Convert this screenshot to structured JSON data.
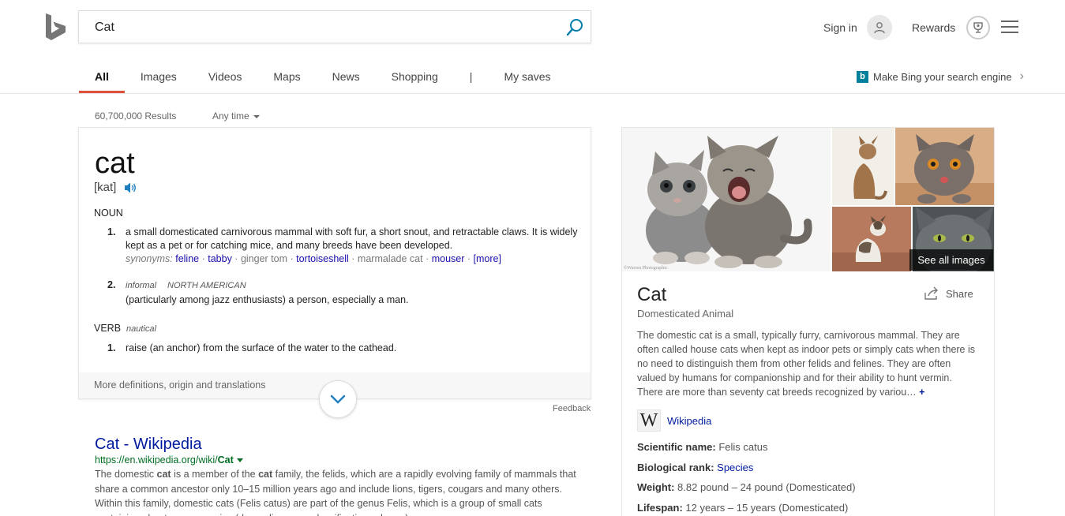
{
  "search": {
    "query": "Cat"
  },
  "header": {
    "signin_label": "Sign in",
    "rewards_label": "Rewards",
    "make_bing_label": "Make Bing your search engine"
  },
  "tabs": [
    {
      "label": "All",
      "active": true
    },
    {
      "label": "Images"
    },
    {
      "label": "Videos"
    },
    {
      "label": "Maps"
    },
    {
      "label": "News"
    },
    {
      "label": "Shopping"
    },
    {
      "label": "|"
    },
    {
      "label": "My saves"
    }
  ],
  "meta": {
    "result_count": "60,700,000 Results",
    "time_filter": "Any time"
  },
  "dictionary": {
    "word": "cat",
    "pronunciation": "[kat]",
    "noun_label": "NOUN",
    "noun_defs": [
      {
        "num": "1.",
        "text": "a small domesticated carnivorous mammal with soft fur, a short snout, and retractable claws. It is widely kept as a pet or for catching mice, and many breeds have been developed."
      },
      {
        "num": "2.",
        "labels": "informal",
        "region": "NORTH AMERICAN",
        "text": "(particularly among jazz enthusiasts) a person, especially a man."
      }
    ],
    "synonyms_label": "synonyms:",
    "synonyms": [
      {
        "text": "feline",
        "link": true
      },
      {
        "text": "tabby",
        "link": true
      },
      {
        "text": "ginger tom",
        "link": false
      },
      {
        "text": "tortoiseshell",
        "link": true
      },
      {
        "text": "marmalade cat",
        "link": false
      },
      {
        "text": "mouser",
        "link": true
      }
    ],
    "more_label": "[more]",
    "verb_label": "VERB",
    "verb_tag": "nautical",
    "verb_defs": [
      {
        "num": "1.",
        "text": "raise (an anchor) from the surface of the water to the cathead."
      }
    ],
    "more_definitions": "More definitions, origin and translations",
    "feedback": "Feedback"
  },
  "wiki_result": {
    "title": "Cat - Wikipedia",
    "url_prefix": "https://en.wikipedia.org/wiki/",
    "url_bold": "Cat",
    "snippet_parts": [
      "The domestic ",
      "cat",
      " is a member of the ",
      "cat",
      " family, the felids, which are a rapidly evolving family of mammals that share a common ancestor only 10–15 million years ago and include lions, tigers, cougars and many others. Within this family, domestic cats (Felis catus) are part of the genus Felis, which is a group of small cats containing about seven species (depending upon classification scheme)"
    ]
  },
  "knowledge_panel": {
    "see_all_images": "See all images",
    "image_watermark": "©Warren Photographic",
    "title": "Cat",
    "subtitle": "Domesticated Animal",
    "share_label": "Share",
    "description": "The domestic cat is a small, typically furry, carnivorous mammal. They are often called house cats when kept as indoor pets or simply cats when there is no need to distinguish them from other felids and felines. They are often valued by humans for companionship and for their ability to hunt vermin. There are more than seventy cat breeds recognized by variou…",
    "plus": "+",
    "source": "Wikipedia",
    "facts": [
      {
        "label": "Scientific name:",
        "value": "Felis catus",
        "link": false
      },
      {
        "label": "Biological rank:",
        "value": "Species",
        "link": true
      },
      {
        "label": "Weight:",
        "value": "8.82 pound – 24 pound (Domesticated)",
        "link": false
      },
      {
        "label": "Lifespan:",
        "value": "12 years – 15 years (Domesticated)",
        "link": false
      }
    ]
  },
  "colors": {
    "accent": "#de4f3c",
    "link": "#001ba0",
    "url": "#006d21",
    "bing_teal": "#00809d"
  }
}
